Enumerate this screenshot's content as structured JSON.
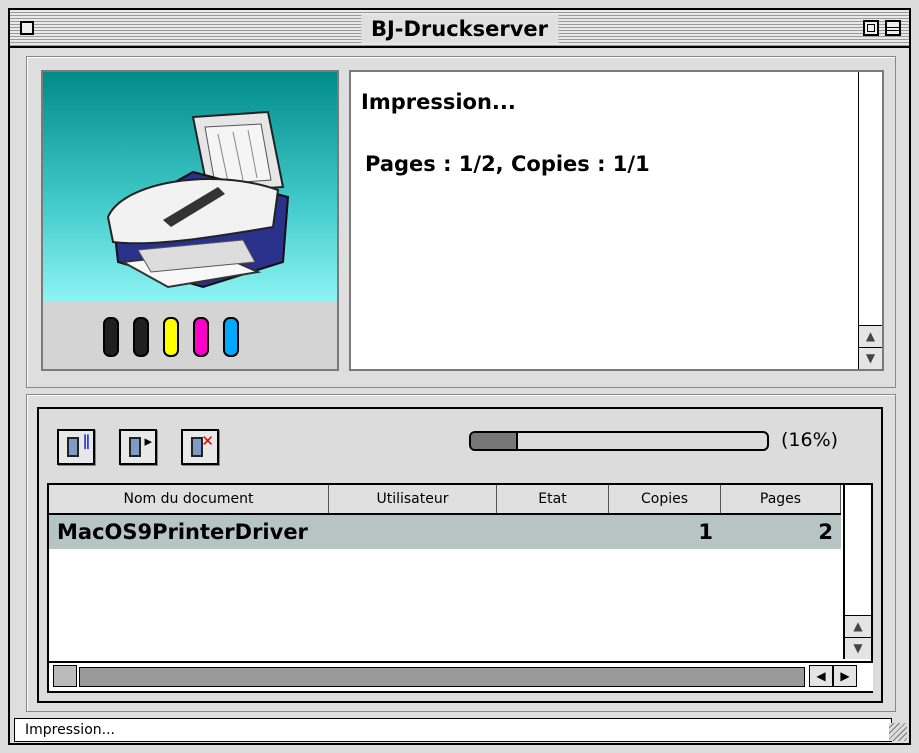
{
  "window": {
    "title": "BJ-Druckserver"
  },
  "status": {
    "text": "Impression...",
    "pages_copies": "Pages : 1/2, Copies : 1/1"
  },
  "ink_colors": [
    "#202020",
    "#202020",
    "#ffff00",
    "#ff00c8",
    "#00a8ff"
  ],
  "toolbar": {
    "buttons": [
      "hold-job-icon",
      "resume-job-icon",
      "delete-job-icon"
    ]
  },
  "progress": {
    "percent": 16,
    "label": "(16%)"
  },
  "table": {
    "columns": [
      "Nom du document",
      "Utilisateur",
      "Etat",
      "Copies",
      "Pages"
    ],
    "rows": [
      {
        "document": "MacOS9PrinterDriver",
        "user": "",
        "state": "",
        "copies": "1",
        "pages": "2"
      }
    ]
  },
  "statusbar": {
    "text": "Impression..."
  }
}
